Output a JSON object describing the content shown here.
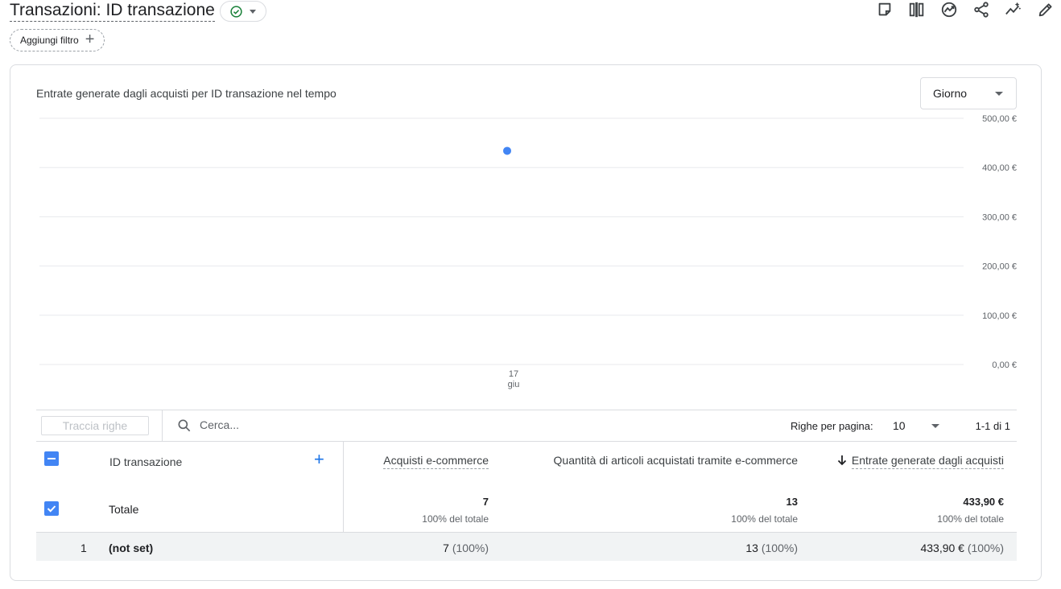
{
  "header": {
    "title": "Transazioni: ID transazione",
    "add_filter_label": "Aggiungi filtro",
    "toolbar_icons": [
      "note-icon",
      "compare-icon",
      "insights-icon",
      "share-icon",
      "trend-icon",
      "edit-icon"
    ]
  },
  "chart": {
    "title": "Entrate generate dagli acquisti per ID transazione nel tempo",
    "granularity": "Giorno",
    "x_tick_day": "17",
    "x_tick_month": "giu",
    "y_ticks": [
      "500,00 €",
      "400,00 €",
      "300,00 €",
      "200,00 €",
      "100,00 €",
      "0,00 €"
    ]
  },
  "chart_data": {
    "type": "line",
    "x": [
      "17 giu"
    ],
    "series": [
      {
        "values": [
          433.9
        ],
        "color": "#4285f4"
      }
    ],
    "ylim": [
      0,
      500
    ],
    "grid": true,
    "y_axis_side": "right"
  },
  "table_toolbar": {
    "track_rows": "Traccia righe",
    "search_placeholder": "Cerca...",
    "rows_per_page_label": "Righe per pagina:",
    "rows_per_page_value": "10",
    "page_range": "1-1 di 1"
  },
  "table": {
    "dimension_header": "ID transazione",
    "metric_headers": [
      "Acquisti e-commerce",
      "Quantità di articoli acquistati tramite e-commerce",
      "Entrate generate dagli acquisti"
    ],
    "totals_label": "Totale",
    "totals": [
      "7",
      "13",
      "433,90 €"
    ],
    "totals_pct": [
      "100% del totale",
      "100% del totale",
      "100% del totale"
    ],
    "rows": [
      {
        "index": "1",
        "dimension": "(not set)",
        "values": [
          "7",
          "13",
          "433,90 €"
        ],
        "pcts": [
          "(100%)",
          "(100%)",
          "(100%)"
        ]
      }
    ]
  }
}
